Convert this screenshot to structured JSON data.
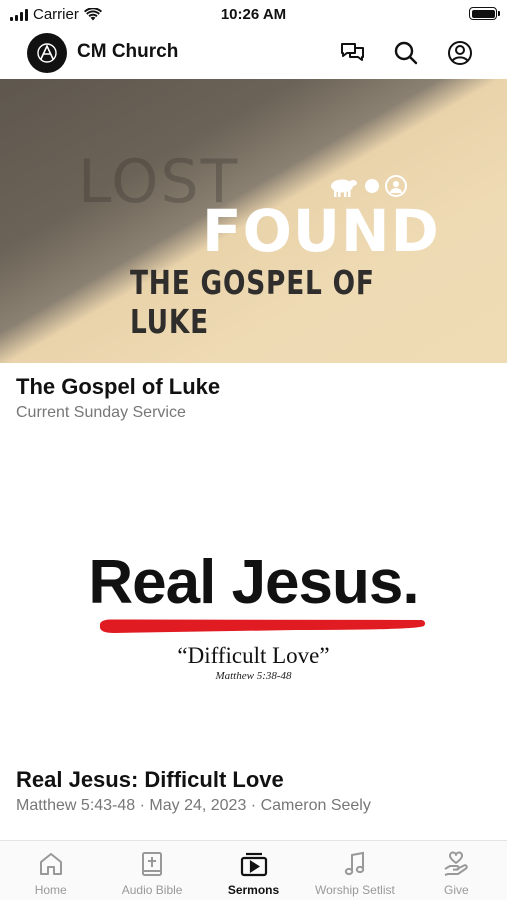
{
  "status_bar": {
    "carrier": "Carrier",
    "time": "10:26 AM"
  },
  "header": {
    "title": "CM Church",
    "logo_icon": "church-logo-icon",
    "icons": [
      "chat-icon",
      "search-icon",
      "profile-icon"
    ]
  },
  "featured": {
    "banner": {
      "lost": "LOST",
      "found": "FOUND",
      "subtitle": "THE GOSPEL OF LUKE"
    },
    "title": "The Gospel of Luke",
    "subtitle": "Current Sunday Service"
  },
  "sermon": {
    "banner": {
      "title": "Real Jesus.",
      "quote": "“Difficult Love”",
      "reference": "Matthew 5:38-48"
    },
    "title": "Real Jesus: Difficult Love",
    "meta": "Matthew 5:43-48 · May 24, 2023 · Cameron Seely"
  },
  "tabs": [
    {
      "label": "Home",
      "icon": "home-icon",
      "active": false
    },
    {
      "label": "Audio Bible",
      "icon": "bible-icon",
      "active": false
    },
    {
      "label": "Sermons",
      "icon": "play-video-icon",
      "active": true
    },
    {
      "label": "Worship Setlist",
      "icon": "music-note-icon",
      "active": false
    },
    {
      "label": "Give",
      "icon": "give-hand-heart-icon",
      "active": false
    }
  ],
  "colors": {
    "accent_red": "#e11b22",
    "active_tab": "#111111",
    "inactive_tab": "#999999"
  }
}
